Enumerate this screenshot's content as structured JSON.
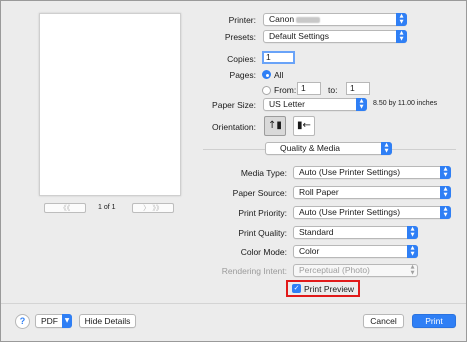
{
  "printer": {
    "label": "Printer:",
    "value": "Canon"
  },
  "presets": {
    "label": "Presets:",
    "value": "Default Settings"
  },
  "copies": {
    "label": "Copies:",
    "value": "1"
  },
  "pages": {
    "label": "Pages:",
    "all_label": "All",
    "from_label": "From:",
    "from_value": "1",
    "to_label": "to:",
    "to_value": "1"
  },
  "paper_size": {
    "label": "Paper Size:",
    "value": "US Letter",
    "dimensions": "8.50 by 11.00 inches"
  },
  "orientation": {
    "label": "Orientation:",
    "portrait_glyph": "↑▮",
    "landscape_glyph": "▮←"
  },
  "section": {
    "value": "Quality & Media"
  },
  "media_type": {
    "label": "Media Type:",
    "value": "Auto (Use Printer Settings)"
  },
  "paper_source": {
    "label": "Paper Source:",
    "value": "Roll Paper"
  },
  "print_priority": {
    "label": "Print Priority:",
    "value": "Auto (Use Printer Settings)"
  },
  "print_quality": {
    "label": "Print Quality:",
    "value": "Standard"
  },
  "color_mode": {
    "label": "Color Mode:",
    "value": "Color"
  },
  "rendering_intent": {
    "label": "Rendering Intent:",
    "value": "Perceptual (Photo)"
  },
  "print_preview": {
    "label": "Print Preview",
    "checked": true
  },
  "pager": {
    "first": "《《",
    "prev": "〈",
    "count": "1 of 1",
    "next": "〉",
    "last": "》》"
  },
  "footer": {
    "help": "?",
    "pdf": "PDF",
    "hide_details": "Hide Details",
    "cancel": "Cancel",
    "print": "Print"
  },
  "colors": {
    "accent": "#2f7ff5",
    "highlight": "#e11a1a"
  }
}
